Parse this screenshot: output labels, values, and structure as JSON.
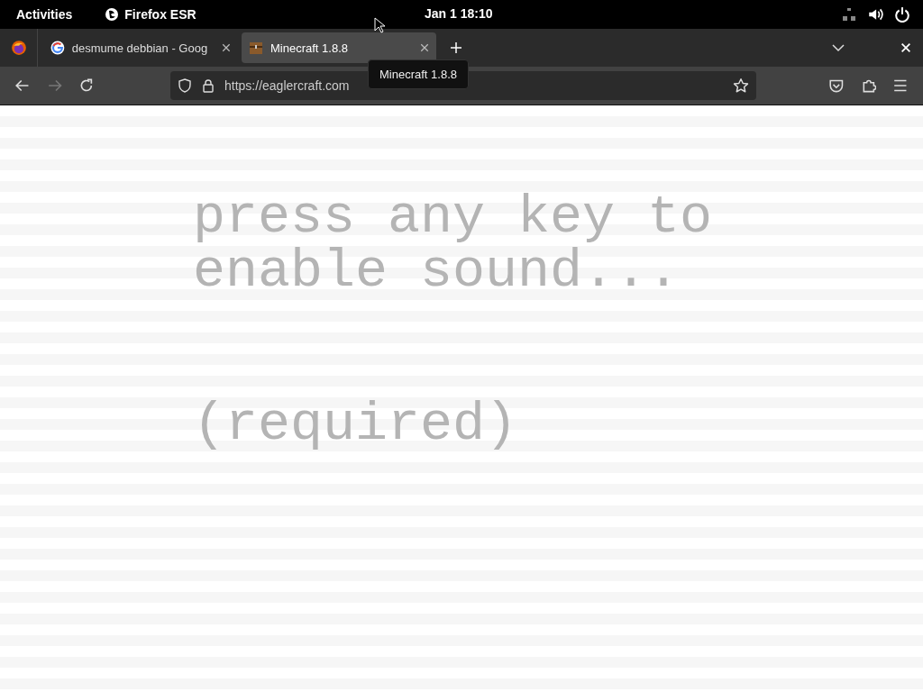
{
  "top_bar": {
    "activities": "Activities",
    "app_name": "Firefox ESR",
    "clock": "Jan 1  18:10"
  },
  "tabs": [
    {
      "title": "desmume debbian - Goog",
      "kind": "google",
      "selected": false
    },
    {
      "title": "Minecraft 1.8.8",
      "kind": "block",
      "selected": true
    }
  ],
  "tab_tooltip": "Minecraft 1.8.8",
  "address_bar": {
    "url": "https://eaglercraft.com"
  },
  "page": {
    "lines": [
      "press any key to",
      "enable sound..."
    ],
    "note": "(required)"
  }
}
